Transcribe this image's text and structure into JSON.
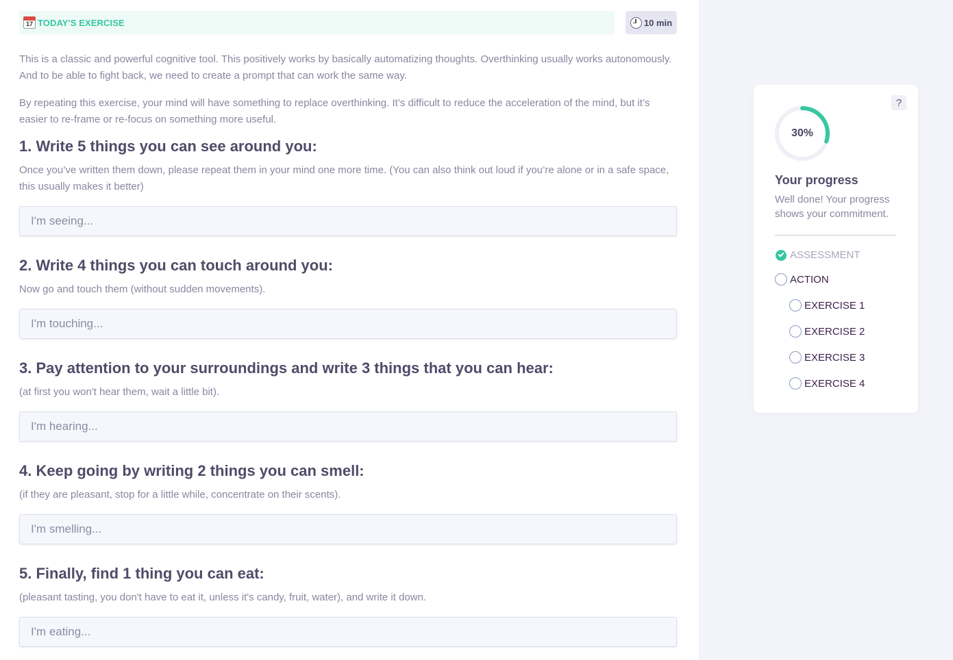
{
  "header": {
    "calendar_icon": "calendar-icon",
    "calendar_day": "17",
    "title": "TODAY'S EXERCISE",
    "clock_icon": "clock-icon",
    "duration": "10 min"
  },
  "intro": {
    "p1": "This is a classic and powerful cognitive tool. This positively works by basically automatizing thoughts. Overthinking usually works autonomously. And to be able to fight back, we need to create a prompt that can work the same way.",
    "p2": "By repeating this exercise, your mind will have something to replace overthinking. It’s difficult to reduce the acceleration of the mind, but it’s easier to re-frame or re-focus on something more useful."
  },
  "steps": [
    {
      "title": "1. Write 5 things you can see around you:",
      "description": "Once you’ve written them down, please repeat them in your mind one more time. (You can also think out loud if you’re alone or in a safe space, this usually makes it better)",
      "placeholder": "I'm seeing...",
      "value": ""
    },
    {
      "title": "2. Write 4 things you can touch around you:",
      "description": "Now go and touch them (without sudden movements).",
      "placeholder": "I'm touching...",
      "value": ""
    },
    {
      "title": "3. Pay attention to your surroundings and write 3 things that you can hear:",
      "description": "(at first you won't hear them, wait a little bit).",
      "placeholder": "I'm hearing...",
      "value": ""
    },
    {
      "title": "4. Keep going by writing 2 things you can smell:",
      "description": "(if they are pleasant, stop for a little while, concentrate on their scents).",
      "placeholder": "I'm smelling...",
      "value": ""
    },
    {
      "title": "5. Finally, find 1 thing you can eat:",
      "description": "(pleasant tasting, you don't have to eat it, unless it's candy, fruit, water), and write it down.",
      "placeholder": "I'm eating...",
      "value": ""
    }
  ],
  "progress": {
    "help_label": "?",
    "percent_label": "30%",
    "fraction": 0.3,
    "title": "Your progress",
    "description": "Well done! Your progress shows your commitment.",
    "colors": {
      "accent": "#36c7a0",
      "track": "#eef0f6"
    },
    "items": [
      {
        "label": "ASSESSMENT",
        "state": "done"
      },
      {
        "label": "ACTION",
        "state": "pending"
      },
      {
        "label": "EXERCISE 1",
        "state": "pending"
      },
      {
        "label": "EXERCISE 2",
        "state": "pending"
      },
      {
        "label": "EXERCISE 3",
        "state": "pending"
      },
      {
        "label": "EXERCISE 4",
        "state": "pending"
      }
    ]
  }
}
